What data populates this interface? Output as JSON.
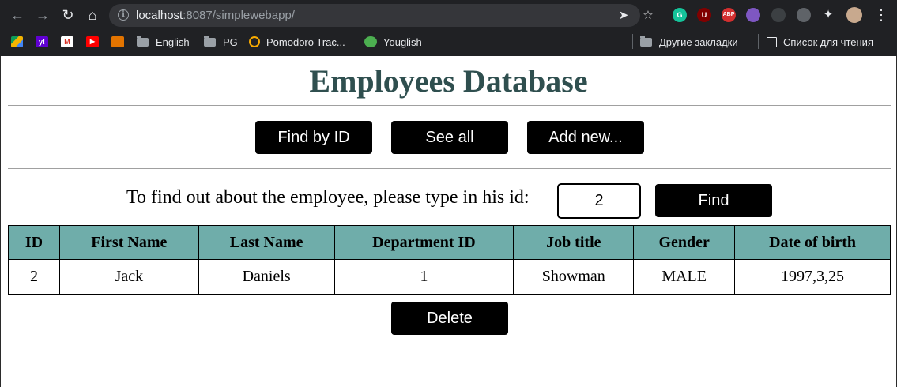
{
  "browser": {
    "url_host": "localhost",
    "url_rest": ":8087/simplewebapp/",
    "bookmarks": [
      {
        "label": "English"
      },
      {
        "label": "PG"
      },
      {
        "label": "Pomodoro Trac..."
      },
      {
        "label": "Youglish"
      }
    ],
    "other_bookmarks": "Другие закладки",
    "reading_list": "Список для чтения",
    "extensions": [
      "grammarly-icon",
      "ublock-icon",
      "adblock-plus-icon",
      "extension-icon",
      "extension-icon",
      "extension-icon",
      "puzzle-icon"
    ],
    "ext_labels": {
      "ublock": "U",
      "abp": "ABP",
      "grammarly": "G"
    }
  },
  "page": {
    "title": "Employees Database",
    "nav_buttons": {
      "find_by_id": "Find by ID",
      "see_all": "See all",
      "add_new": "Add new..."
    },
    "search": {
      "prompt": "To find out about the employee, please type in his id:",
      "value": "2",
      "find_label": "Find"
    },
    "table": {
      "headers": [
        "ID",
        "First Name",
        "Last Name",
        "Department ID",
        "Job title",
        "Gender",
        "Date of birth"
      ],
      "rows": [
        [
          "2",
          "Jack",
          "Daniels",
          "1",
          "Showman",
          "MALE",
          "1997,3,25"
        ]
      ]
    },
    "delete_label": "Delete"
  },
  "colors": {
    "title": "#2f4f4f",
    "header_bg": "#6fadaa",
    "button_bg": "#000000",
    "button_text": "#ffffff"
  }
}
